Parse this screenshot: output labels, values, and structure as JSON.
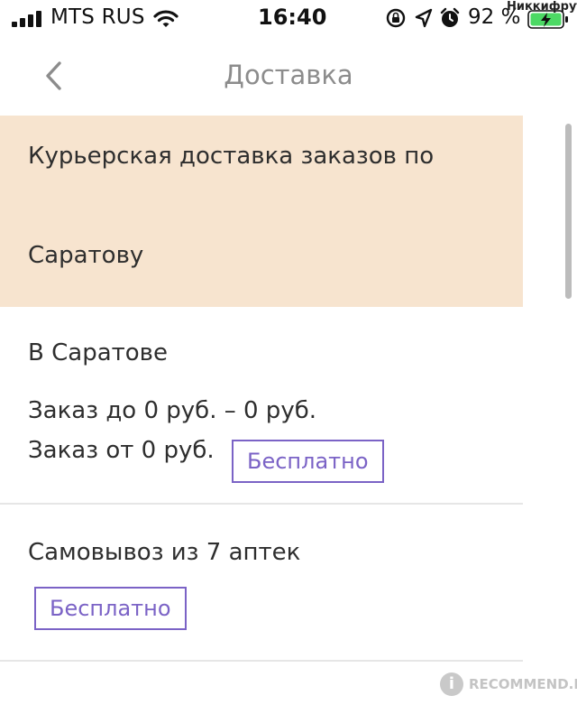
{
  "status_bar": {
    "carrier": "MTS RUS",
    "time": "16:40",
    "battery_percent": "92 %",
    "watermark_user": "Никкифрут",
    "icons": [
      "signal-icon",
      "wifi-icon",
      "orientation-lock-icon",
      "location-icon",
      "alarm-icon",
      "battery-charging-icon"
    ]
  },
  "nav": {
    "back_icon": "chevron-left-icon",
    "title": "Доставка"
  },
  "banner": {
    "line1": "Курьерская доставка заказов по",
    "line2": "Саратову"
  },
  "city_section": {
    "title": "В Саратове",
    "row1": "Заказ до 0 руб.  – 0 руб.",
    "row2": "Заказ от 0 руб.",
    "badge": "Бесплатно"
  },
  "pickup_section": {
    "title": "Самовывоз из 7 аптек",
    "badge": "Бесплатно"
  },
  "watermark": {
    "text": "RECOMMEND.RU"
  },
  "colors": {
    "banner_bg": "#f7e4cf",
    "accent": "#7b63c6",
    "title_gray": "#8c8c8c",
    "battery_green": "#4cd964"
  }
}
